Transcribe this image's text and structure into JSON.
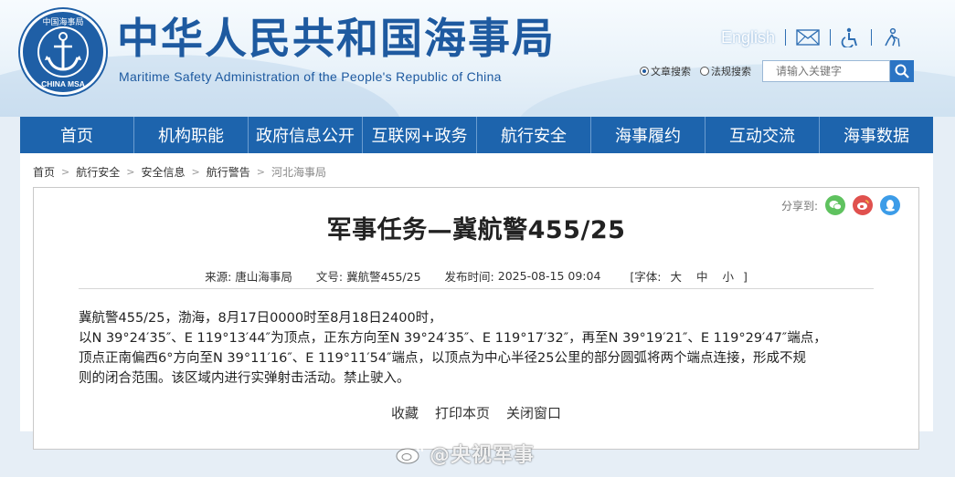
{
  "header": {
    "logo_text_top": "中国海事局",
    "logo_text_bottom": "CHINA MSA",
    "title": "中华人民共和国海事局",
    "subtitle": "Maritime Safety Administration of the People's Republic of China",
    "english_link": "English",
    "icons": [
      "mail-icon",
      "accessibility-icon",
      "elderly-mode-icon"
    ]
  },
  "search": {
    "options": [
      {
        "label": "文章搜索",
        "selected": true
      },
      {
        "label": "法规搜索",
        "selected": false
      }
    ],
    "placeholder": "请输入关键字"
  },
  "nav": {
    "items": [
      "首页",
      "机构职能",
      "政府信息公开",
      "互联网+政务",
      "航行安全",
      "海事履约",
      "互动交流",
      "海事数据"
    ]
  },
  "breadcrumb": [
    "首页",
    "航行安全",
    "安全信息",
    "航行警告",
    "河北海事局"
  ],
  "share": {
    "label": "分享到:",
    "targets": [
      "wechat-icon",
      "weibo-icon",
      "qq-icon"
    ]
  },
  "article": {
    "title": "军事任务—冀航警455/25",
    "source_label": "来源:",
    "source": "唐山海事局",
    "docno_label": "文号:",
    "docno": "冀航警455/25",
    "time_label": "发布时间:",
    "time": "2025-08-15 09:04",
    "font_label": "[字体:",
    "font_sizes": [
      "大",
      "中",
      "小"
    ],
    "font_close": "]",
    "paragraphs": [
      "冀航警455/25，渤海，8月17日0000时至8月18日2400时，",
      "以N 39°24′35″、E 119°13′44″为顶点，正东方向至N 39°24′35″、E 119°17′32″，再至N 39°19′21″、E 119°29′47″端点，",
      "顶点正南偏西6°方向至N 39°11′16″、E 119°11′54″端点，以顶点为中心半径25公里的部分圆弧将两个端点连接，形成不规",
      "则的闭合范围。该区域内进行实弹射击活动。禁止驶入。"
    ],
    "actions": [
      "收藏",
      "打印本页",
      "关闭窗口"
    ]
  },
  "watermark": "@央视军事",
  "colors": {
    "brand_blue": "#1d64ad",
    "title_blue": "#1e5aa0",
    "wechat": "#5fc25f",
    "weibo": "#e0514e",
    "qq": "#3c9ce8"
  }
}
